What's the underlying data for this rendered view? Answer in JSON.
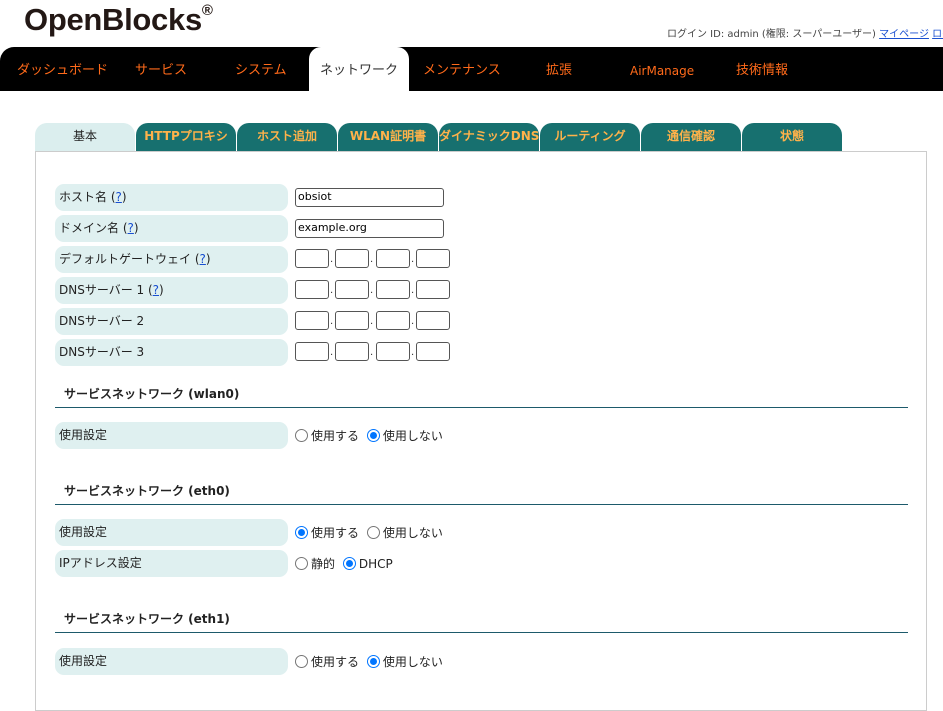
{
  "header": {
    "logo_text": "OpenBlocks",
    "logo_mark": "®",
    "login_text": "ログイン ID: admin (権限: スーパーユーザー)",
    "mypage_link": "マイページ",
    "logout_link": "ログ"
  },
  "nav": {
    "items": [
      {
        "label": "ダッシュボード"
      },
      {
        "label": "サービス"
      },
      {
        "label": "システム"
      },
      {
        "label": "ネットワーク"
      },
      {
        "label": "メンテナンス"
      },
      {
        "label": "拡張"
      },
      {
        "label": "AirManage"
      },
      {
        "label": "技術情報"
      }
    ],
    "active_index": 3
  },
  "subtabs": {
    "items": [
      {
        "label": "基本"
      },
      {
        "label": "HTTPプロキシ"
      },
      {
        "label": "ホスト追加"
      },
      {
        "label": "WLAN証明書"
      },
      {
        "label": "ダイナミックDNS"
      },
      {
        "label": "ルーティング"
      },
      {
        "label": "通信確認"
      },
      {
        "label": "状態"
      }
    ],
    "active_index": 0
  },
  "form": {
    "help_mark": "?",
    "hostname": {
      "label": "ホスト名",
      "value": "obsiot"
    },
    "domain": {
      "label": "ドメイン名",
      "value": "example.org"
    },
    "gateway": {
      "label": "デフォルトゲートウェイ"
    },
    "dns1": {
      "label": "DNSサーバー 1"
    },
    "dns2": {
      "label": "DNSサーバー 2"
    },
    "dns3": {
      "label": "DNSサーバー 3"
    }
  },
  "sections": {
    "wlan0": {
      "title": "サービスネットワーク (wlan0)",
      "usage_label": "使用設定",
      "use": "使用する",
      "nouse": "使用しない",
      "selected": "nouse"
    },
    "eth0": {
      "title": "サービスネットワーク (eth0)",
      "usage_label": "使用設定",
      "use": "使用する",
      "nouse": "使用しない",
      "selected": "use",
      "ip_label": "IPアドレス設定",
      "static": "静的",
      "dhcp": "DHCP",
      "ip_selected": "dhcp"
    },
    "eth1": {
      "title": "サービスネットワーク (eth1)",
      "usage_label": "使用設定",
      "use": "使用する",
      "nouse": "使用しない",
      "selected": "nouse"
    }
  }
}
